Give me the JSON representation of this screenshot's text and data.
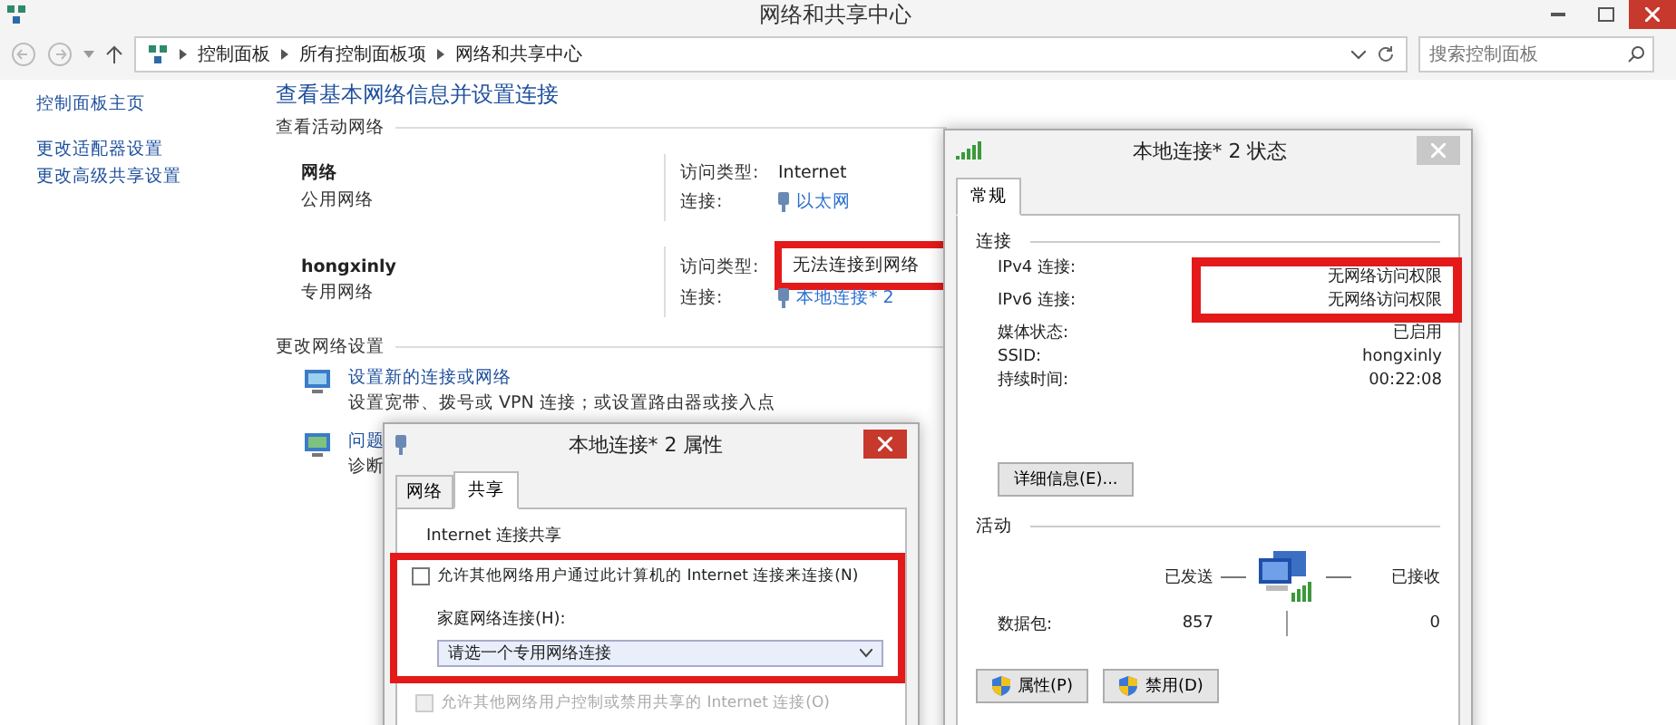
{
  "window": {
    "title": "网络和共享中心"
  },
  "address_bar": {
    "path": [
      "控制面板",
      "所有控制面板项",
      "网络和共享中心"
    ],
    "search_placeholder": "搜索控制面板"
  },
  "sidebar": {
    "items": [
      "控制面板主页",
      "更改适配器设置",
      "更改高级共享设置"
    ]
  },
  "main": {
    "heading": "查看基本网络信息并设置连接",
    "active_label": "查看活动网络",
    "networks": [
      {
        "name": "网络",
        "type": "公用网络",
        "access_label": "访问类型:",
        "access": "Internet",
        "connection_label": "连接:",
        "connection": "以太网",
        "highlighted": false
      },
      {
        "name": "hongxinly",
        "type": "专用网络",
        "access_label": "访问类型:",
        "access": "无法连接到网络",
        "connection_label": "连接:",
        "connection": "本地连接* 2",
        "highlighted": true
      }
    ],
    "settings_label": "更改网络设置",
    "tasks": [
      {
        "title": "设置新的连接或网络",
        "description": "设置宽带、拨号或 VPN 连接；或设置路由器或接入点"
      },
      {
        "title": "问题",
        "description": "诊断"
      }
    ]
  },
  "status_dialog": {
    "title": "本地连接* 2 状态",
    "tab": "常规",
    "connection_label": "连接",
    "rows": [
      {
        "label": "IPv4 连接:",
        "value": "无网络访问权限",
        "highlighted": true
      },
      {
        "label": "IPv6 连接:",
        "value": "无网络访问权限",
        "highlighted": true
      },
      {
        "label": "媒体状态:",
        "value": "已启用",
        "highlighted": false
      },
      {
        "label": "SSID:",
        "value": "hongxinly",
        "highlighted": false
      },
      {
        "label": "持续时间:",
        "value": "00:22:08",
        "highlighted": false
      }
    ],
    "details_button": "详细信息(E)...",
    "activity_label": "活动",
    "sent_label": "已发送",
    "received_label": "已接收",
    "packets_label": "数据包:",
    "sent": "857",
    "received": "0",
    "buttons": [
      "属性(P)",
      "禁用(D)"
    ]
  },
  "properties_dialog": {
    "title": "本地连接* 2 属性",
    "tabs": [
      {
        "label": "网络",
        "selected": false
      },
      {
        "label": "共享",
        "selected": true
      }
    ],
    "group_label": "Internet 连接共享",
    "highlighted": true,
    "allow_sharing": {
      "label": "允许其他网络用户通过此计算机的 Internet 连接来连接(N)",
      "checked": false,
      "disabled": false
    },
    "home_label": "家庭网络连接(H):",
    "home_value": "请选一个专用网络连接",
    "allow_control": {
      "label": "允许其他网络用户控制或禁用共享的 Internet 连接(O)",
      "checked": false,
      "disabled": true
    }
  }
}
